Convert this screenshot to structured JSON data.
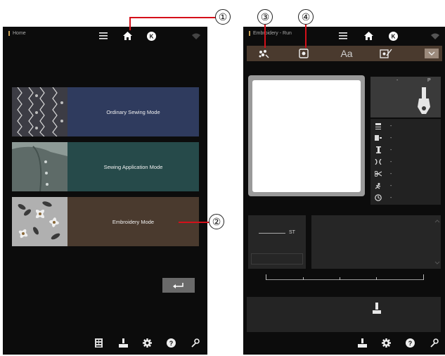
{
  "home": {
    "title": "Home",
    "modes": [
      {
        "label": "Ordinary Sewing Mode",
        "color": "#2f3b5e"
      },
      {
        "label": "Sewing Application Mode",
        "color": "#264a4a"
      },
      {
        "label": "Embroidery Mode",
        "color": "#4a3a2e"
      }
    ],
    "bottom_icons": [
      "pattern-icon",
      "presser-foot-icon",
      "settings-icon",
      "help-icon",
      "wrench-icon"
    ]
  },
  "embroidery": {
    "title": "Embroidery - Run",
    "tabs": [
      "pattern-edit-icon",
      "embroidery-frame-icon",
      "text-icon",
      "frame-move-icon",
      "dropdown-icon"
    ],
    "text_tab": "Aa",
    "info_header": {
      "left": "-",
      "right": "P"
    },
    "info_rows": [
      "-",
      "-",
      "-",
      "-",
      "-",
      "-",
      "-"
    ],
    "stitch_label": "ST",
    "bottom_icons": [
      "presser-foot-icon",
      "settings-icon",
      "help-icon",
      "wrench-icon"
    ]
  },
  "callouts": [
    "①",
    "②",
    "③",
    "④"
  ],
  "colors": {
    "accent": "#c8a055",
    "callout_line": "#d4101a"
  }
}
